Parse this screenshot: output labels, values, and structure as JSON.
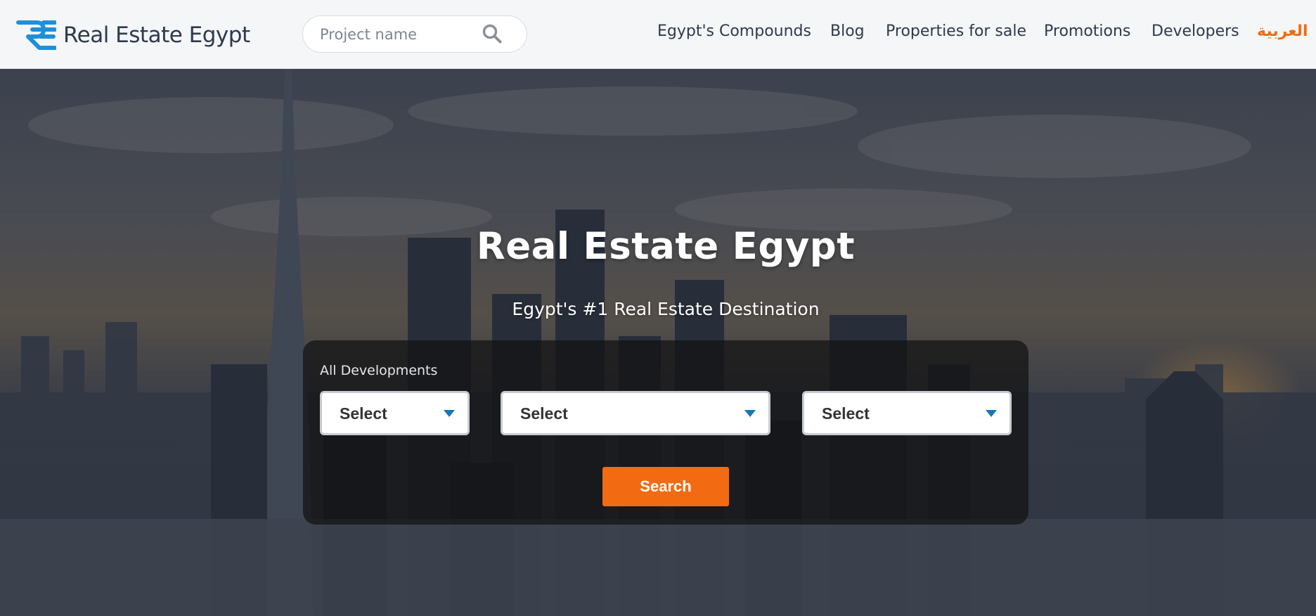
{
  "header": {
    "logo_text": "Real Estate Egypt",
    "search": {
      "placeholder": "Project name",
      "value": ""
    },
    "nav": [
      {
        "label": "Egypt's Compounds"
      },
      {
        "label": "Blog"
      },
      {
        "label": "Properties for sale"
      },
      {
        "label": "Promotions"
      },
      {
        "label": "Developers"
      },
      {
        "label": "العربية"
      }
    ]
  },
  "hero": {
    "title": "Real Estate Egypt",
    "subtitle": "Egypt's #1 Real Estate Destination",
    "search_panel": {
      "label": "All Developments",
      "selects": [
        {
          "value": "Select"
        },
        {
          "value": "Select"
        },
        {
          "value": "Select"
        }
      ],
      "search_label": "Search"
    }
  },
  "colors": {
    "accent": "#f26b12",
    "logo_blue": "#1e90d8",
    "nav_text": "#2e3a4c",
    "caret_blue": "#1478b8"
  },
  "icons": {
    "search": "search-icon",
    "dropdown": "caret-down-icon"
  }
}
